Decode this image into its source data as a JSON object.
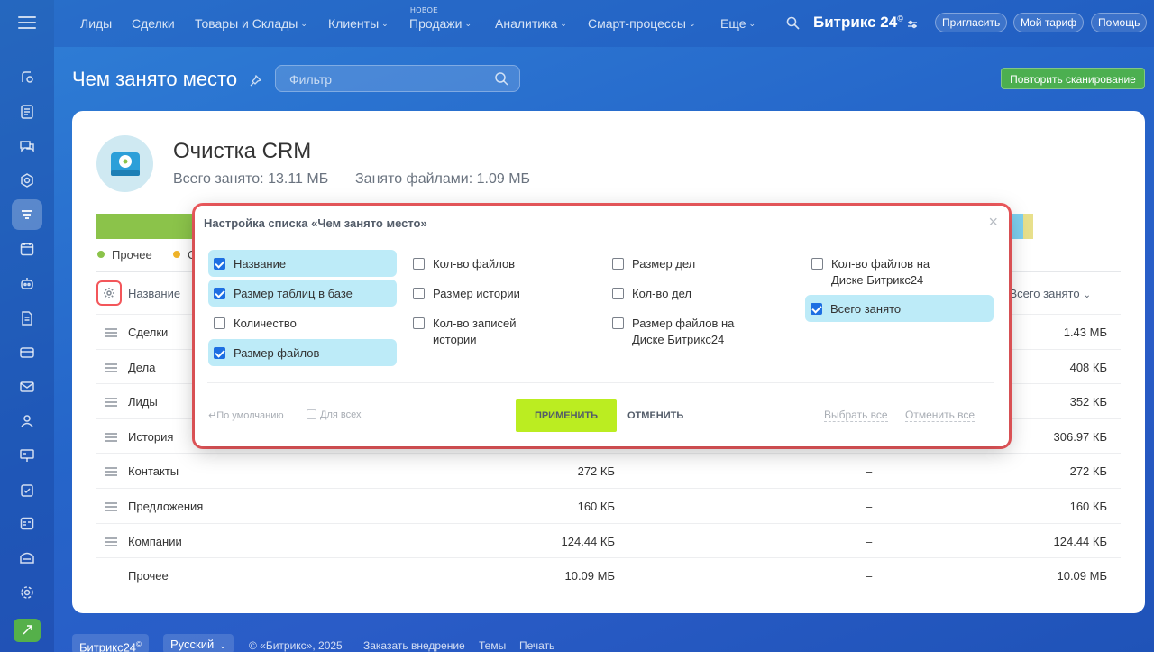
{
  "nav": {
    "items": [
      {
        "label": "Лиды",
        "chevron": false
      },
      {
        "label": "Сделки",
        "chevron": false
      },
      {
        "label": "Товары и Склады",
        "chevron": true
      },
      {
        "label": "Клиенты",
        "chevron": true
      },
      {
        "label": "Продажи",
        "chevron": true
      },
      {
        "label": "Аналитика",
        "chevron": true
      },
      {
        "label": "Смарт-процессы",
        "chevron": true
      },
      {
        "label": "Еще",
        "chevron": true
      }
    ],
    "new_badge": "НОВОЕ",
    "brand": "Битрикс 24",
    "brand_mark": "©",
    "invite": "Пригласить",
    "tariff": "Мой тариф",
    "help": "Помощь"
  },
  "header": {
    "title": "Чем занято место",
    "filter_placeholder": "Фильтр",
    "rescan": "Повторить сканирование"
  },
  "panel": {
    "title": "Очистка CRM",
    "total": "Всего занято: 13.11 МБ",
    "files": "Занято файлами: 1.09 МБ",
    "legend": [
      {
        "label": "Прочее",
        "color": "#8bc34a"
      },
      {
        "label": "С",
        "color": "#f0b429"
      }
    ],
    "bar_segments": [
      {
        "color": "#8bc34a",
        "share": 0.77
      },
      {
        "color": "#2f9fd6",
        "share": 0.045
      },
      {
        "color": "#2d5ea8",
        "share": 0.03
      },
      {
        "color": "#a5d36a",
        "share": 0.02
      },
      {
        "color": "#e06a6a",
        "share": 0.02
      },
      {
        "color": "#7ed0ef",
        "share": 0.02
      },
      {
        "color": "#e8e08c",
        "share": 0.01
      }
    ],
    "columns": {
      "name": "Название",
      "total": "Всего занято"
    },
    "rows": [
      {
        "name": "Сделки",
        "v1": "",
        "v2": "",
        "v3": "1.43 МБ",
        "drag": true
      },
      {
        "name": "Дела",
        "v1": "",
        "v2": "",
        "v3": "408 КБ",
        "drag": true
      },
      {
        "name": "Лиды",
        "v1": "",
        "v2": "",
        "v3": "352 КБ",
        "drag": true
      },
      {
        "name": "История",
        "v1": "",
        "v2": "",
        "v3": "306.97 КБ",
        "drag": true
      },
      {
        "name": "Контакты",
        "v1": "272 КБ",
        "v2": "–",
        "v3": "272 КБ",
        "drag": true
      },
      {
        "name": "Предложения",
        "v1": "160 КБ",
        "v2": "–",
        "v3": "160 КБ",
        "drag": true
      },
      {
        "name": "Компании",
        "v1": "124.44 КБ",
        "v2": "–",
        "v3": "124.44 КБ",
        "drag": true
      },
      {
        "name": "Прочее",
        "v1": "10.09 МБ",
        "v2": "–",
        "v3": "10.09 МБ",
        "drag": false
      }
    ]
  },
  "dialog": {
    "title": "Настройка списка «Чем занято место»",
    "options": [
      {
        "label": "Название",
        "checked": true
      },
      {
        "label": "Размер таблиц в базе",
        "checked": true
      },
      {
        "label": "Количество",
        "checked": false
      },
      {
        "label": "Размер файлов",
        "checked": true
      },
      {
        "label": "Кол-во файлов",
        "checked": false
      },
      {
        "label": "Размер истории",
        "checked": false
      },
      {
        "label": "Кол-во записей истории",
        "checked": false
      },
      {
        "label": "Размер дел",
        "checked": false
      },
      {
        "label": "Кол-во дел",
        "checked": false
      },
      {
        "label": "Размер файлов на Диске Битрикс24",
        "checked": false
      },
      {
        "label": "Кол-во файлов на Диске Битрикс24",
        "checked": false
      },
      {
        "label": "Всего занято",
        "checked": true
      }
    ],
    "default": "По умолчанию",
    "for_all": "Для всех",
    "apply": "ПРИМЕНИТЬ",
    "cancel": "ОТМЕНИТЬ",
    "select_all": "Выбрать все",
    "deselect_all": "Отменить все"
  },
  "footer": {
    "brand": "Битрикс24",
    "language": "Русский",
    "copyright": "© «Битрикс», 2025",
    "order": "Заказать внедрение",
    "themes": "Темы",
    "print": "Печать"
  }
}
